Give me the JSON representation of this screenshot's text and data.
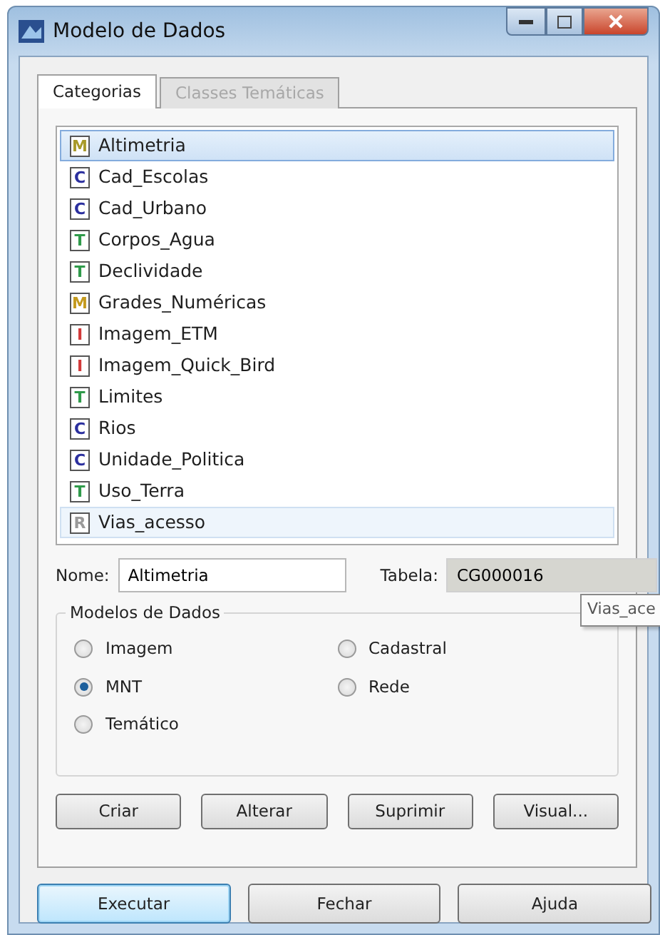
{
  "window": {
    "title": "Modelo de Dados"
  },
  "tabs": [
    {
      "label": "Categorias",
      "selected": true,
      "disabled": false
    },
    {
      "label": "Classes Temáticas",
      "selected": false,
      "disabled": true
    }
  ],
  "categories": [
    {
      "badge": "M",
      "name": "Altimetria",
      "color": "#a89a2a",
      "selected": true,
      "hovered": false
    },
    {
      "badge": "C",
      "name": "Cad_Escolas",
      "color": "#2b2f9e",
      "selected": false,
      "hovered": false
    },
    {
      "badge": "C",
      "name": "Cad_Urbano",
      "color": "#2b2f9e",
      "selected": false,
      "hovered": false
    },
    {
      "badge": "T",
      "name": "Corpos_Agua",
      "color": "#2f9a4a",
      "selected": false,
      "hovered": false
    },
    {
      "badge": "T",
      "name": "Declividade",
      "color": "#2f9a4a",
      "selected": false,
      "hovered": false
    },
    {
      "badge": "M",
      "name": "Grades_Numéricas",
      "color": "#c49a1e",
      "selected": false,
      "hovered": false
    },
    {
      "badge": "I",
      "name": "Imagem_ETM",
      "color": "#d23a3a",
      "selected": false,
      "hovered": false
    },
    {
      "badge": "I",
      "name": "Imagem_Quick_Bird",
      "color": "#d23a3a",
      "selected": false,
      "hovered": false
    },
    {
      "badge": "T",
      "name": "Limites",
      "color": "#2f9a4a",
      "selected": false,
      "hovered": false
    },
    {
      "badge": "C",
      "name": "Rios",
      "color": "#2b2f9e",
      "selected": false,
      "hovered": false
    },
    {
      "badge": "C",
      "name": "Unidade_Politica",
      "color": "#2b2f9e",
      "selected": false,
      "hovered": false
    },
    {
      "badge": "T",
      "name": "Uso_Terra",
      "color": "#2f9a4a",
      "selected": false,
      "hovered": false
    },
    {
      "badge": "R",
      "name": "Vias_acesso",
      "color": "#9a9a9a",
      "selected": false,
      "hovered": true
    }
  ],
  "name_field": {
    "label": "Nome:",
    "value": "Altimetria"
  },
  "table_field": {
    "label": "Tabela:",
    "value": "CG000016",
    "disabled": true
  },
  "tooltip": "Vias_ace",
  "data_models": {
    "title": "Modelos de Dados",
    "options": [
      {
        "label": "Imagem",
        "selected": false
      },
      {
        "label": "Cadastral",
        "selected": false
      },
      {
        "label": "MNT",
        "selected": true
      },
      {
        "label": "Rede",
        "selected": false
      },
      {
        "label": "Temático",
        "selected": false
      }
    ]
  },
  "actions": [
    "Criar",
    "Alterar",
    "Suprimir",
    "Visual..."
  ],
  "footer_buttons": [
    {
      "label": "Executar",
      "default": true
    },
    {
      "label": "Fechar",
      "default": false
    },
    {
      "label": "Ajuda",
      "default": false
    }
  ]
}
